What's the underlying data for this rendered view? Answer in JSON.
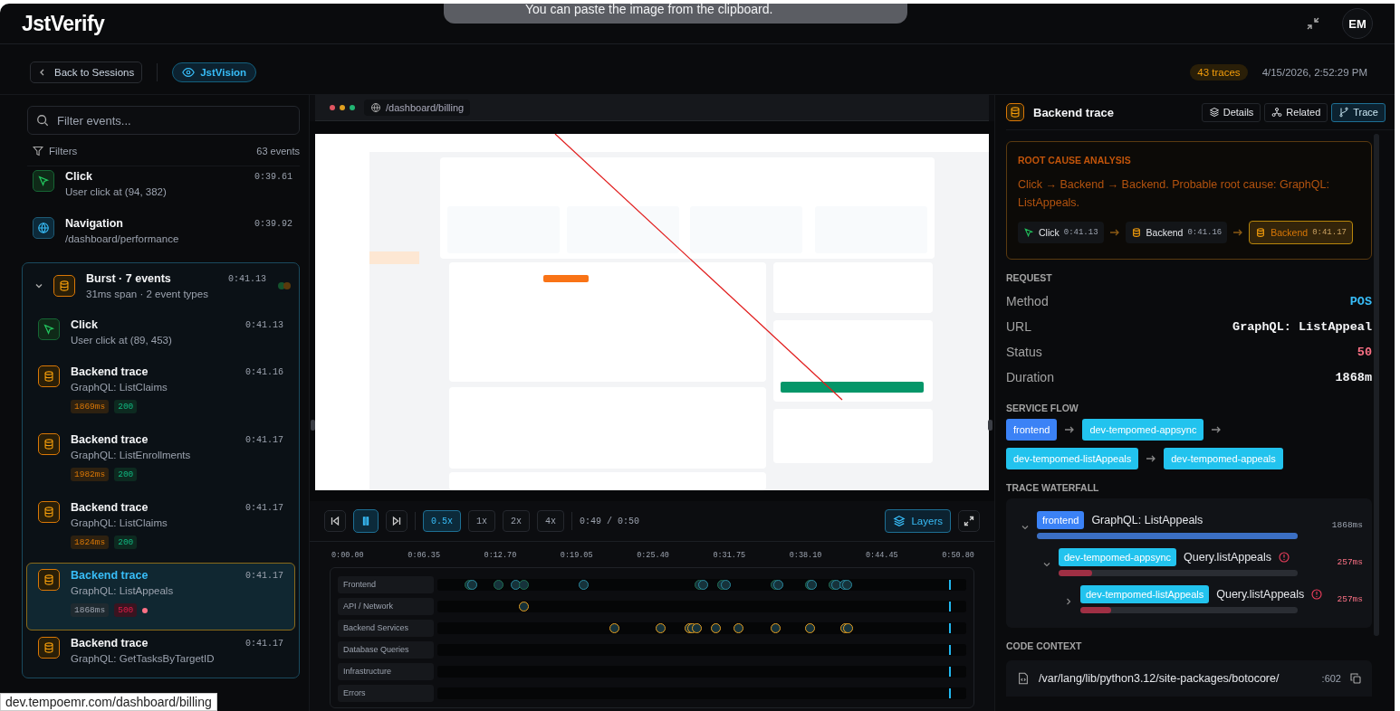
{
  "toast": {
    "text": "You can paste the image from the clipboard."
  },
  "header": {
    "logo": "JstVerify",
    "avatar": "EM"
  },
  "toolbar": {
    "back": "Back to Sessions",
    "vision": "JstVision",
    "traces": "43 traces",
    "timestamp": "4/15/2026, 2:52:29 PM"
  },
  "sidebar": {
    "search_placeholder": "Filter events...",
    "filters": "Filters",
    "count": "63 events",
    "events": [
      {
        "kind": "click",
        "title": "Click",
        "subtitle": "User click at (94, 382)",
        "time": "0:39.61"
      },
      {
        "kind": "navigation",
        "title": "Navigation",
        "subtitle": "/dashboard/performance",
        "time": "0:39.92"
      }
    ],
    "burst": {
      "title": "Burst · 7 events",
      "subtitle": "31ms span · 2 event types",
      "time": "0:41.13",
      "expanded": true,
      "events": [
        {
          "kind": "click",
          "title": "Click",
          "subtitle": "User click at (89, 453)",
          "time": "0:41.13",
          "selected": false
        },
        {
          "kind": "backend",
          "title": "Backend trace",
          "subtitle": "GraphQL: ListClaims",
          "time": "0:41.16",
          "duration": "1869ms",
          "status": "200",
          "error": false,
          "selected": false
        },
        {
          "kind": "backend",
          "title": "Backend trace",
          "subtitle": "GraphQL: ListEnrollments",
          "time": "0:41.17",
          "duration": "1982ms",
          "status": "200",
          "error": false,
          "selected": false
        },
        {
          "kind": "backend",
          "title": "Backend trace",
          "subtitle": "GraphQL: ListClaims",
          "time": "0:41.17",
          "duration": "1824ms",
          "status": "200",
          "error": false,
          "selected": false
        },
        {
          "kind": "backend",
          "title": "Backend trace",
          "subtitle": "GraphQL: ListAppeals",
          "time": "0:41.17",
          "duration": "1868ms",
          "status": "500",
          "error": true,
          "selected": true
        },
        {
          "kind": "backend",
          "title": "Backend trace",
          "subtitle": "GraphQL: GetTasksByTargetID",
          "time": "0:41.17",
          "selected": false
        }
      ]
    }
  },
  "player": {
    "url": "/dashboard/billing",
    "speeds": [
      {
        "label": "0.5x",
        "selected": true
      },
      {
        "label": "1x",
        "selected": false
      },
      {
        "label": "2x",
        "selected": false
      },
      {
        "label": "4x",
        "selected": false
      }
    ],
    "playing": true,
    "time": "0:49 / 0:50",
    "layers": "Layers",
    "ticks": [
      "0:00.00",
      "0:06.35",
      "0:12.70",
      "0:19.05",
      "0:25.40",
      "0:31.75",
      "0:38.10",
      "0:44.45",
      "0:50.80"
    ],
    "tracks": [
      "Frontend",
      "API / Network",
      "Backend Services",
      "Database Queries",
      "Infrastructure",
      "Errors"
    ]
  },
  "detail": {
    "title": "Backend trace",
    "tabs": [
      {
        "label": "Details",
        "kind": "details",
        "selected": false
      },
      {
        "label": "Related",
        "kind": "related",
        "selected": false
      },
      {
        "label": "Trace",
        "kind": "trace",
        "selected": true
      }
    ],
    "root_cause": {
      "heading": "ROOT CAUSE ANALYSIS",
      "text": "Click → Backend → Backend. Probable root cause: GraphQL: ListAppeals.",
      "steps": [
        {
          "kind": "click",
          "label": "Click",
          "time": "0:41.13",
          "selected": false
        },
        {
          "kind": "backend",
          "label": "Backend",
          "time": "0:41.16",
          "selected": false
        },
        {
          "kind": "backend",
          "label": "Backend",
          "time": "0:41.17",
          "selected": true
        }
      ]
    },
    "request": {
      "heading": "REQUEST",
      "rows": [
        {
          "kind": "method",
          "label": "Method",
          "value": "POS"
        },
        {
          "kind": "url",
          "label": "URL",
          "value": "GraphQL: ListAppeal"
        },
        {
          "kind": "status",
          "label": "Status",
          "value": "50"
        },
        {
          "kind": "duration",
          "label": "Duration",
          "value": "1868m"
        }
      ]
    },
    "service_flow": {
      "heading": "SERVICE FLOW",
      "services": [
        {
          "kind": "frontend",
          "name": "frontend"
        },
        {
          "kind": "service",
          "name": "dev-tempomed-appsync"
        },
        {
          "kind": "service",
          "name": "dev-tempomed-listAppeals"
        },
        {
          "kind": "service",
          "name": "dev-tempomed-appeals"
        }
      ]
    },
    "waterfall": {
      "heading": "TRACE WATERFALL",
      "spans": [
        {
          "kind": "frontend",
          "service": "frontend",
          "operation": "GraphQL: ListAppeals",
          "duration": "1868ms",
          "error": false,
          "expanded": true,
          "level": 1,
          "children": [
            {
              "kind": "service",
              "service": "dev-tempomed-appsync",
              "operation": "Query.listAppeals",
              "duration": "257ms",
              "error": true,
              "expanded": true,
              "level": 0.14,
              "children": [
                {
                  "kind": "service",
                  "service": "dev-tempomed-listAppeals",
                  "operation": "Query.listAppeals",
                  "duration": "257ms",
                  "error": true,
                  "expanded": false,
                  "level": 0.14
                }
              ]
            }
          ]
        }
      ]
    },
    "code_context": {
      "heading": "CODE CONTEXT",
      "path": "/var/lang/lib/python3.12/site-packages/botocore/",
      "line": ":602"
    }
  },
  "status_url": "dev.tempoemr.com/dashboard/billing"
}
